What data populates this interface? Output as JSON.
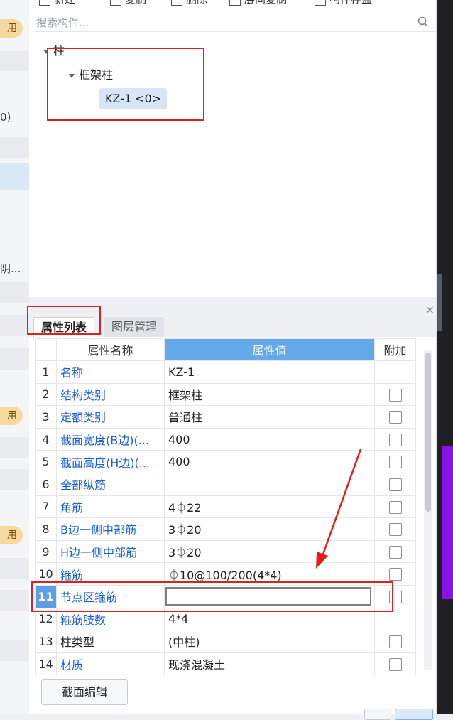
{
  "toolbar": {
    "new_label": "新建",
    "copy_label": "复制",
    "delete_label": "删除",
    "layer_copy_label": "层间复制",
    "save_label": "构件存盘"
  },
  "search": {
    "placeholder": "搜索构件..."
  },
  "tree": {
    "root_label": "柱",
    "group_label": "框架柱",
    "item_label": "KZ-1 <0>"
  },
  "left_strip": {
    "pill_label": "用",
    "text_1": "0)",
    "text_2": "阴..."
  },
  "tabs": {
    "properties": "属性列表",
    "layers": "图层管理",
    "close_symbol": "×"
  },
  "table": {
    "headers": {
      "name": "属性名称",
      "value": "属性值",
      "extra": "附加"
    },
    "rows": [
      {
        "num": "1",
        "name": "名称",
        "value": "KZ-1"
      },
      {
        "num": "2",
        "name": "结构类别",
        "value": "框架柱"
      },
      {
        "num": "3",
        "name": "定额类别",
        "value": "普通柱"
      },
      {
        "num": "4",
        "name": "截面宽度(B边)(...",
        "value": "400"
      },
      {
        "num": "5",
        "name": "截面高度(H边)(...",
        "value": "400"
      },
      {
        "num": "6",
        "name": "全部纵筋",
        "value": ""
      },
      {
        "num": "7",
        "name": "角筋",
        "value": "4⏀22"
      },
      {
        "num": "8",
        "name": "B边一侧中部筋",
        "value": "3⏀20"
      },
      {
        "num": "9",
        "name": "H边一侧中部筋",
        "value": "3⏀20"
      },
      {
        "num": "10",
        "name": "箍筋",
        "value": "⏀10@100/200(4*4)"
      },
      {
        "num": "11",
        "name": "节点区箍筋",
        "value": ""
      },
      {
        "num": "12",
        "name": "箍筋肢数",
        "value": "4*4"
      },
      {
        "num": "13",
        "name": "柱类型",
        "value": "(中柱)"
      },
      {
        "num": "14",
        "name": "材质",
        "value": "现浇混凝土"
      }
    ]
  },
  "buttons": {
    "section_edit": "截面编辑"
  },
  "colors": {
    "accent_blue": "#66a9ea",
    "selected_row": "#5c9fe6",
    "link_blue": "#1b5fd1",
    "annotation_red": "#e02020",
    "purple": "#8a12e8"
  }
}
